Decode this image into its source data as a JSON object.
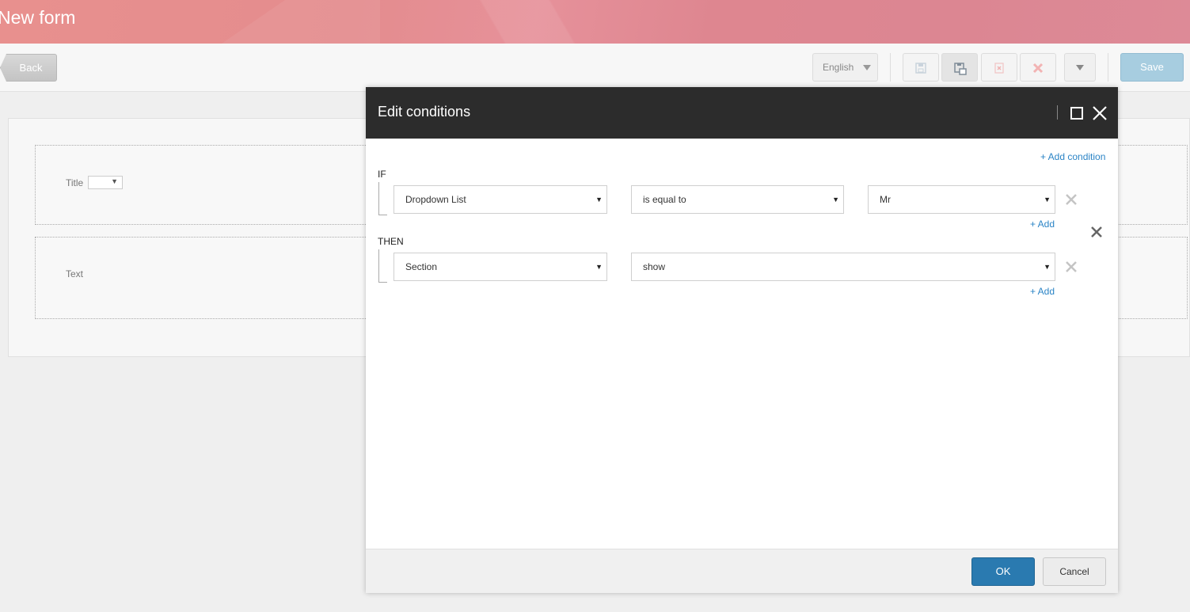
{
  "header": {
    "title": "New form"
  },
  "toolbar": {
    "back_label": "Back",
    "language": "English",
    "save_label": "Save"
  },
  "form": {
    "fields": [
      {
        "label": "Title"
      },
      {
        "label": "Text"
      }
    ]
  },
  "dialog": {
    "title": "Edit conditions",
    "add_condition_label": "+ Add condition",
    "if_label": "IF",
    "then_label": "THEN",
    "if_row": {
      "field": "Dropdown List",
      "operator": "is equal to",
      "value": "Mr"
    },
    "then_row": {
      "target": "Section",
      "action": "show"
    },
    "add_label": "+ Add",
    "ok_label": "OK",
    "cancel_label": "Cancel"
  },
  "colors": {
    "accent": "#2a7ab0",
    "link": "#2b84c6",
    "banner": "#e48c8e",
    "dialog_header": "#2c2c2c"
  }
}
